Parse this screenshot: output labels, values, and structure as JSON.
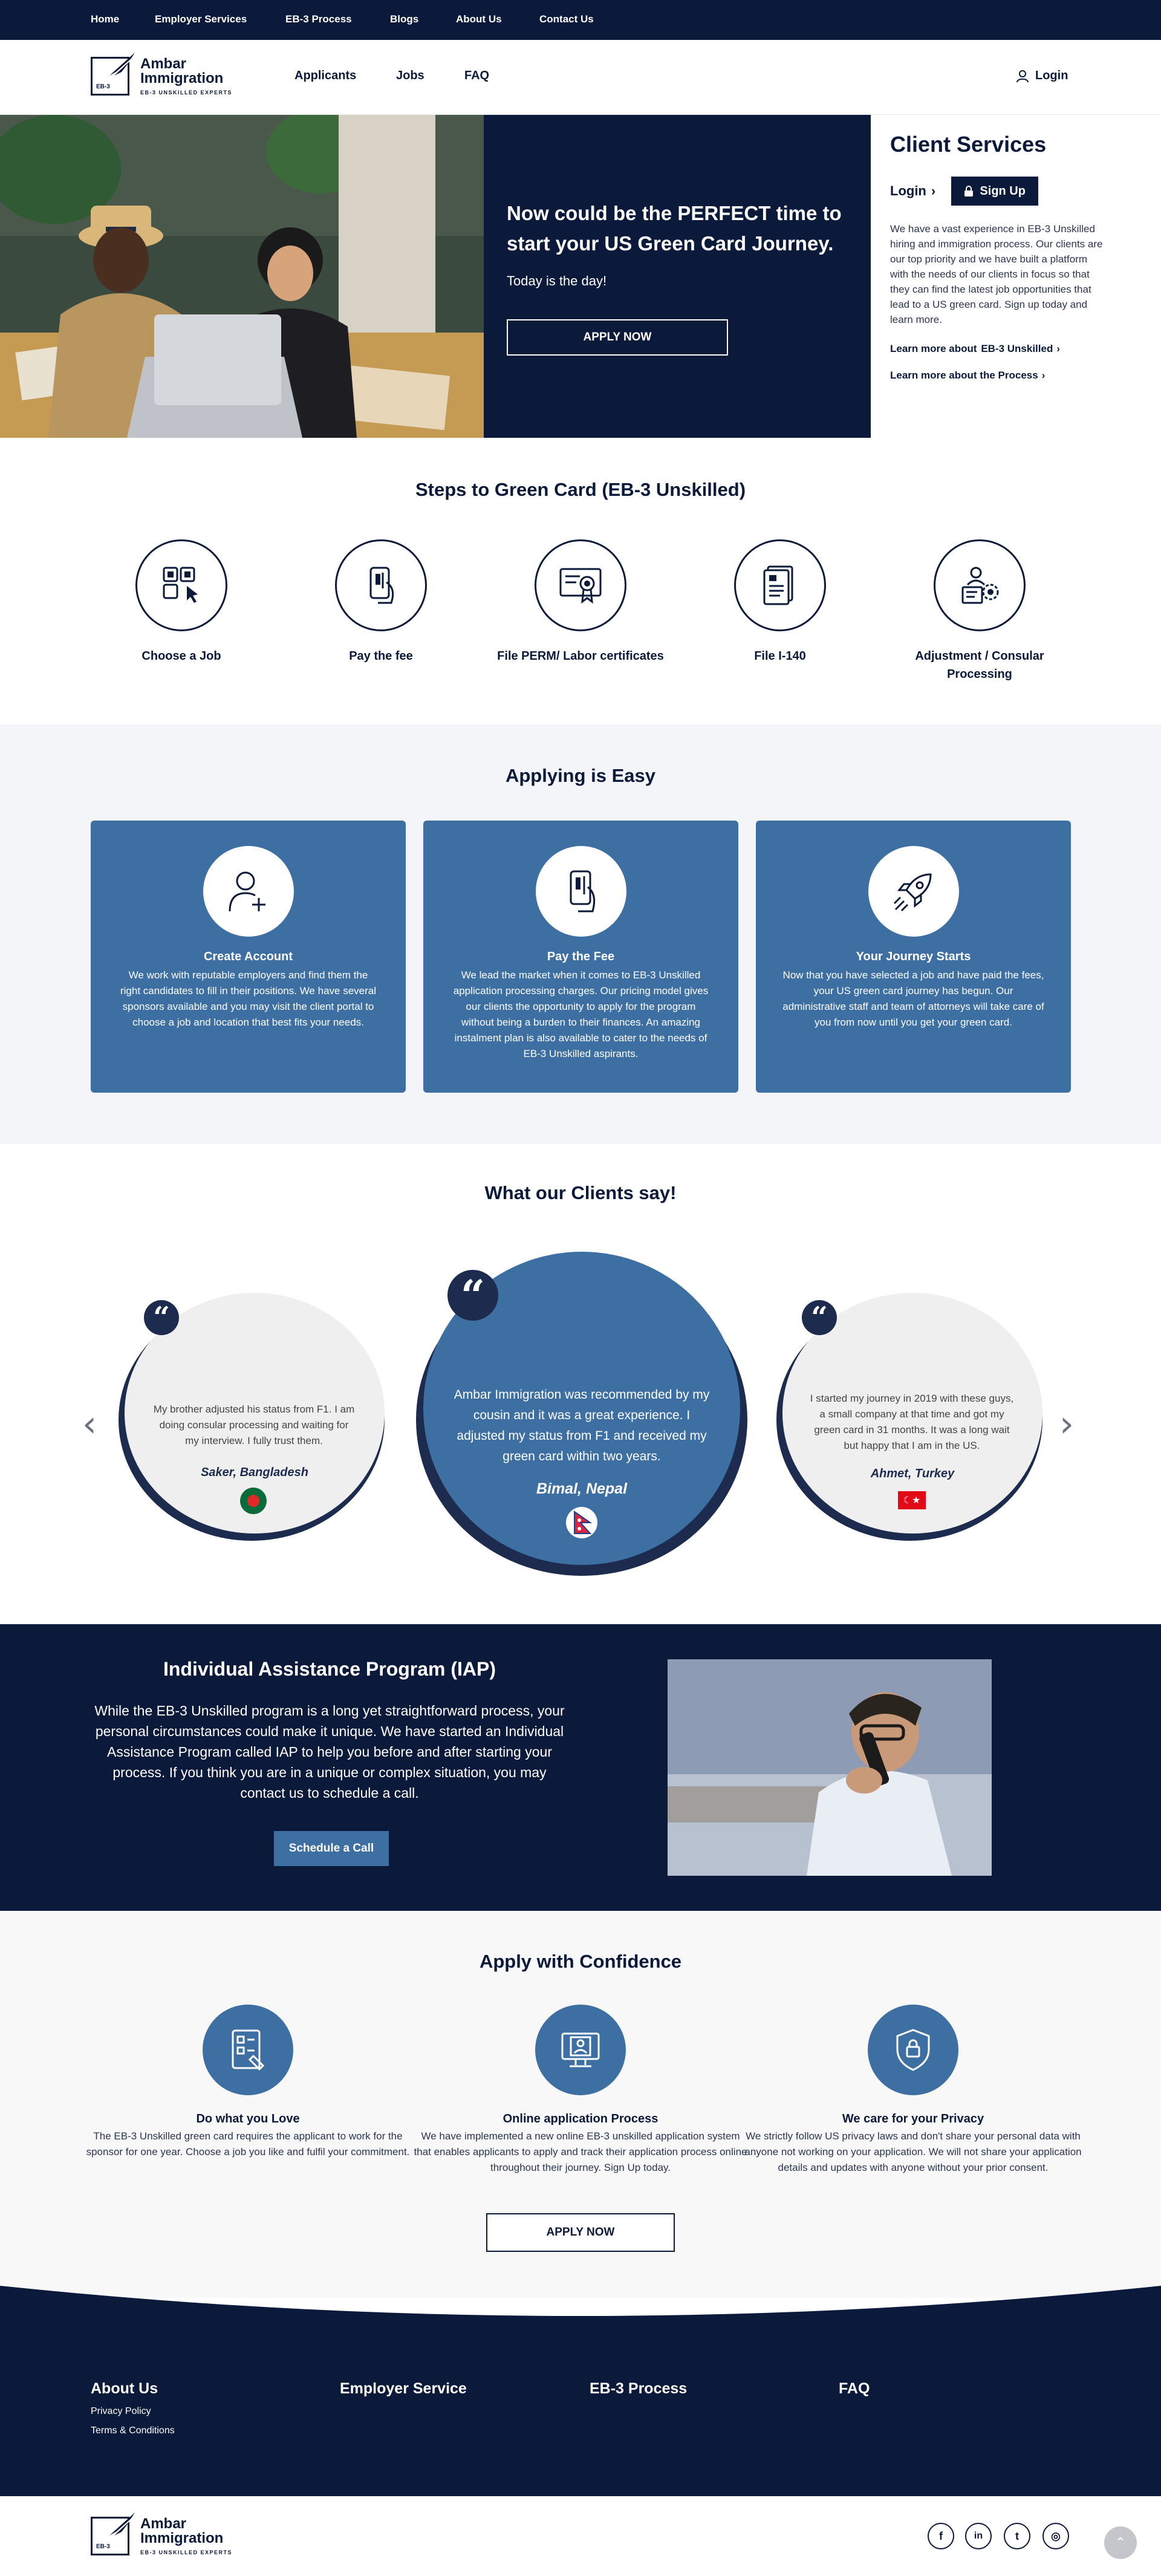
{
  "topnav": [
    "Home",
    "Employer Services",
    "EB-3 Process",
    "Blogs",
    "About Us",
    "Contact Us"
  ],
  "logo": {
    "name": "Ambar Immigration",
    "tagline": "EB-3 UNSKILLED EXPERTS",
    "mark": "EB-3"
  },
  "mainnav": [
    "Applicants",
    "Jobs",
    "FAQ"
  ],
  "header_login": "Login",
  "hero": {
    "title": "Now could be the PERFECT time to start your US Green Card Journey.",
    "subtitle": "Today is the day!",
    "cta": "APPLY NOW"
  },
  "client_services": {
    "title": "Client Services",
    "login": "Login",
    "signup": "Sign Up",
    "description": "We have a vast experience in EB-3 Unskilled hiring and immigration process. Our clients are our top priority and we have built a platform with the needs of our clients in focus so that they can find the latest job opportunities that lead to a US green card. Sign up today and learn more.",
    "link1_prefix": "Learn more about ",
    "link1_bold": "EB-3 Unskilled",
    "link2": "Learn more about the Process"
  },
  "steps": {
    "title": "Steps to Green Card (EB-3 Unskilled)",
    "items": [
      {
        "label": "Choose a Job",
        "icon": "job-board-icon"
      },
      {
        "label": "Pay the fee",
        "icon": "card-payment-icon"
      },
      {
        "label": "File PERM/ Labor certificates",
        "icon": "certificate-icon"
      },
      {
        "label": "File I-140",
        "icon": "document-icon"
      },
      {
        "label": "Adjustment / Consular Processing",
        "icon": "processing-icon"
      }
    ]
  },
  "easy": {
    "title": "Applying is Easy",
    "cards": [
      {
        "title": "Create Account",
        "text": "We work with reputable employers and find them the right candidates to fill in their positions. We have several sponsors available and you may visit the client portal to choose a job and location that best fits your needs.",
        "icon": "add-user-icon"
      },
      {
        "title": "Pay the Fee",
        "text": "We lead the market when it comes to EB-3 Unskilled application processing charges. Our pricing model gives our clients the opportunity to apply for the program without being a burden to their finances. An amazing instalment plan is also available to cater to the needs of EB-3 Unskilled aspirants.",
        "icon": "card-payment-icon"
      },
      {
        "title": "Your Journey Starts",
        "text": "Now that you have selected a job and have paid the fees, your US green card journey has begun. Our administrative staff and team of attorneys will take care of you from now until you get your green card.",
        "icon": "rocket-icon"
      }
    ]
  },
  "testimonials": {
    "title": "What our Clients say!",
    "items": [
      {
        "quote": "My brother adjusted his status from F1. I am doing consular processing and waiting for my interview. I fully trust them.",
        "author": "Saker, Bangladesh",
        "flag": "bangladesh-flag-icon"
      },
      {
        "quote": "Ambar Immigration was recommended by my cousin and it was a great experience. I adjusted my status from F1 and received my green card within two years.",
        "author": "Bimal, Nepal",
        "flag": "nepal-flag-icon"
      },
      {
        "quote": "I started my journey in 2019 with these guys, a small company at that time and got my green card in 31 months. It was a long wait but happy that I am in the US.",
        "author": "Ahmet, Turkey",
        "flag": "turkey-flag-icon"
      }
    ]
  },
  "iap": {
    "title": "Individual Assistance Program (IAP)",
    "text": "While the EB-3 Unskilled program is a long yet straightforward process, your personal circumstances could make it unique. We have started an Individual Assistance Program called IAP to help you before and after starting your process. If you think you are in a unique or complex situation, you may contact us to schedule a call.",
    "cta": "Schedule a Call"
  },
  "confidence": {
    "title": "Apply with Confidence",
    "items": [
      {
        "title": "Do what you Love",
        "text": "The EB-3 Unskilled green card requires the applicant to work for the sponsor for one year. Choose a job you like and fulfil your commitment.",
        "icon": "checklist-icon"
      },
      {
        "title": "Online application Process",
        "text": "We have implemented a new online EB-3 unskilled application system that enables applicants to apply and track their application process online throughout their journey. Sign Up today.",
        "icon": "online-application-icon"
      },
      {
        "title": "We care for your Privacy",
        "text": "We strictly follow US privacy laws and don't share your personal data with anyone not working on your application. We will not share your application details and updates with anyone without your prior consent.",
        "icon": "shield-lock-icon"
      }
    ],
    "cta": "APPLY NOW"
  },
  "footer": {
    "cols": [
      "About Us",
      "Employer Service",
      "EB-3 Process",
      "FAQ"
    ],
    "links": [
      "Privacy Policy",
      "Terms & Conditions"
    ]
  },
  "social": [
    {
      "icon": "facebook-icon",
      "glyph": "f"
    },
    {
      "icon": "linkedin-icon",
      "glyph": "in"
    },
    {
      "icon": "twitter-icon",
      "glyph": "t"
    },
    {
      "icon": "instagram-icon",
      "glyph": "◎"
    }
  ],
  "colors": {
    "navy": "#0b1a3a",
    "blue": "#3e6fa3",
    "light": "#f4f5f8"
  }
}
